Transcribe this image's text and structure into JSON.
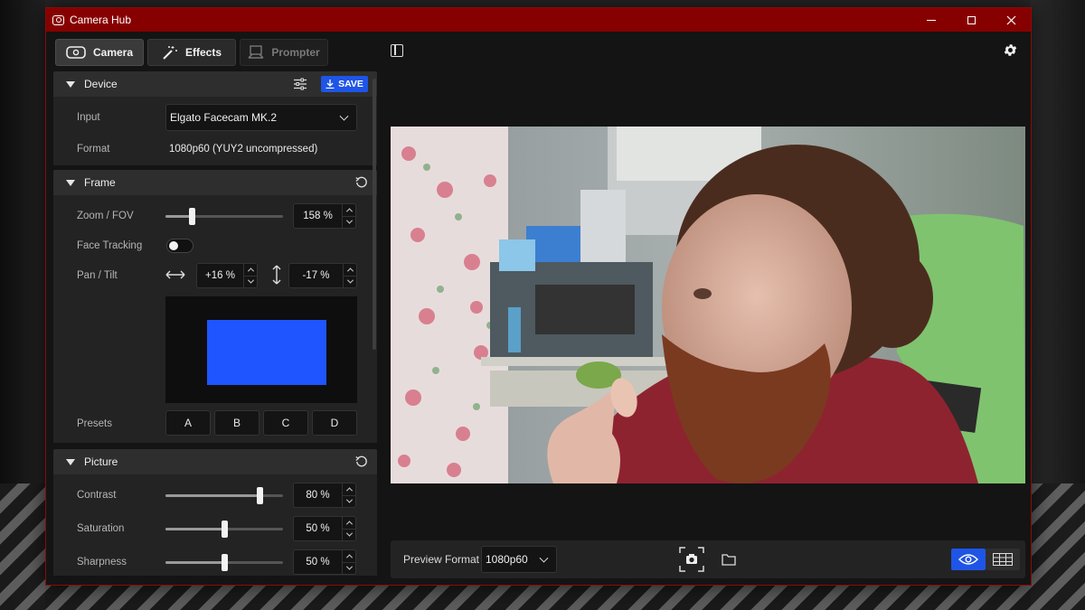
{
  "window": {
    "title": "Camera Hub"
  },
  "tabs": [
    {
      "label": "Camera",
      "icon": "camera-icon",
      "state": "active"
    },
    {
      "label": "Effects",
      "icon": "magic-wand-icon",
      "state": "normal"
    },
    {
      "label": "Prompter",
      "icon": "prompter-icon",
      "state": "disabled"
    }
  ],
  "device": {
    "title": "Device",
    "save_label": "SAVE",
    "input_label": "Input",
    "input_value": "Elgato Facecam MK.2",
    "format_label": "Format",
    "format_value": "1080p60 (YUY2 uncompressed)"
  },
  "frame": {
    "title": "Frame",
    "zoom_label": "Zoom / FOV",
    "zoom_value": "158 %",
    "zoom_level": 0.22,
    "face_tracking_label": "Face Tracking",
    "face_tracking_on": false,
    "pan_tilt_label": "Pan / Tilt",
    "pan_value": "+16 %",
    "tilt_value": "-17 %",
    "presets_label": "Presets",
    "presets": [
      "A",
      "B",
      "C",
      "D"
    ]
  },
  "picture": {
    "title": "Picture",
    "rows": [
      {
        "label": "Contrast",
        "value": "80 %",
        "level": 0.8
      },
      {
        "label": "Saturation",
        "value": "50 %",
        "level": 0.5
      },
      {
        "label": "Sharpness",
        "value": "50 %",
        "level": 0.5
      }
    ]
  },
  "preview": {
    "format_label": "Preview Format",
    "format_value": "1080p60"
  },
  "colors": {
    "titlebar": "#870000",
    "accent": "#1f55e6"
  }
}
